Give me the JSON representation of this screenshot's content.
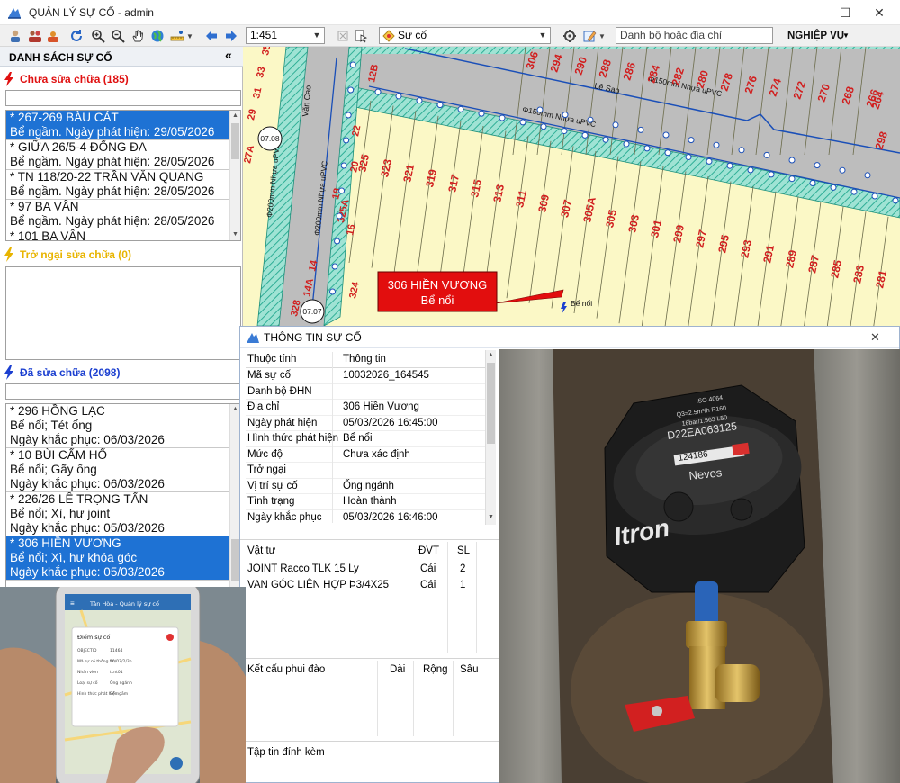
{
  "window": {
    "title": "QUẢN LÝ SỰ CỐ - admin",
    "minimize": "—",
    "maximize": "☐",
    "close": "✕"
  },
  "toolbar": {
    "scale_value": "1:451",
    "layer_value": "Sự cố",
    "search_placeholder": "Danh bộ hoặc địa chỉ",
    "menu_label": "NGHIỆP VỤ"
  },
  "left_panel": {
    "title": "DANH SÁCH SỰ CỐ",
    "collapse_icon": "«",
    "sections": {
      "pending": {
        "label": "Chưa sửa chữa (185)",
        "color": "#e01010",
        "items": [
          {
            "line1": "* 267-269 BÀU CÁT",
            "line2": "Bể ngầm. Ngày phát hiện: 29/05/2026",
            "selected": true
          },
          {
            "line1": "* GIỮA 26/5-4 ĐỐNG ĐA",
            "line2": "Bể ngầm. Ngày phát hiện: 28/05/2026"
          },
          {
            "line1": "* TN 118/20-22 TRẦN VĂN QUANG",
            "line2": "Bể ngầm. Ngày phát hiện: 28/05/2026"
          },
          {
            "line1": "* 97 BA VÂN",
            "line2": "Bể ngầm. Ngày phát hiện: 28/05/2026"
          },
          {
            "line1": "* 101 BA VÂN",
            "line2": ""
          }
        ]
      },
      "blocked": {
        "label": "Trở ngại sửa chữa (0)",
        "color": "#e8b400"
      },
      "fixed": {
        "label": "Đã sửa chữa (2098)",
        "color": "#1b3fd0",
        "items": [
          {
            "line1": "* 296 HỒNG LẠC",
            "line2": "Bể nổi; Tét ống",
            "line3": "Ngày khắc phục: 06/03/2026"
          },
          {
            "line1": "* 10 BÙI CẨM HỔ",
            "line2": "Bể nổi; Gãy ống",
            "line3": "Ngày khắc phục: 06/03/2026"
          },
          {
            "line1": "* 226/26 LÊ TRỌNG TẤN",
            "line2": "Bể nổi; Xì, hư joint",
            "line3": "Ngày khắc phục: 05/03/2026"
          },
          {
            "line1": "* 306 HIỀN VƯƠNG",
            "line2": "Bể nổi; Xì, hư khóa góc",
            "line3": "Ngày khắc phục: 05/03/2026",
            "selected": true
          }
        ]
      }
    }
  },
  "map": {
    "callout_title": "306 HIỀN VƯƠNG",
    "callout_sub": "Bể nổi",
    "marker_label": "Bể nổi",
    "street_van_cao": "Văn Cao",
    "street_le_sao": "Lê Sao",
    "pipe_le_sao": "Φ150mm Nhựa uPVC",
    "pipe_le_sao_2": "Φ150mm Nhựa uPVC",
    "pipe_van_cao": "Φ200mm Nhựa uPVC",
    "pipe_van_cao_2": "Φ200mm Nhựa uPVC",
    "zone_1": "07.08",
    "zone_2": "07.07",
    "parcels_top": [
      "306",
      "294",
      "290",
      "288",
      "286",
      "284",
      "282",
      "280",
      "278",
      "276",
      "274",
      "272",
      "270",
      "268",
      "266"
    ],
    "parcels_top2": [
      "298",
      "264"
    ],
    "parcels_mid": [
      "325",
      "323",
      "321",
      "319",
      "317",
      "315",
      "313",
      "311",
      "309",
      "307",
      "305A",
      "305",
      "303",
      "301",
      "299",
      "297",
      "295",
      "293",
      "291",
      "289",
      "287",
      "285",
      "283",
      "281"
    ],
    "parcels_left": [
      "35",
      "33",
      "31",
      "29",
      "27A",
      "22",
      "20",
      "16",
      "14",
      "14A",
      "12B",
      "325A",
      "324",
      "328",
      "18"
    ]
  },
  "info_window": {
    "title": "THÔNG TIN SỰ CỐ",
    "close": "✕",
    "header_attr": "Thuộc tính",
    "header_val": "Thông tin",
    "rows": [
      {
        "k": "Mã sự cố",
        "v": "10032026_164545"
      },
      {
        "k": "Danh bộ ĐHN",
        "v": ""
      },
      {
        "k": "Địa chỉ",
        "v": "306 Hiền Vương"
      },
      {
        "k": "Ngày phát hiện",
        "v": "05/03/2026 16:45:00"
      },
      {
        "k": "Hình thức phát hiện",
        "v": "Bể nổi"
      },
      {
        "k": "Mức độ",
        "v": "Chưa xác định"
      },
      {
        "k": "Trở ngại",
        "v": ""
      },
      {
        "k": "Vị trí sự cố",
        "v": "Ống ngánh"
      },
      {
        "k": "Tình trạng",
        "v": "Hoàn thành"
      },
      {
        "k": "Ngày khắc phục",
        "v": "05/03/2026 16:46:00"
      }
    ],
    "materials_headers": [
      "Vật tư",
      "ĐVT",
      "SL"
    ],
    "materials": [
      {
        "name": "JOINT Racco TLK 15 Ly",
        "unit": "Cái",
        "qty": "2"
      },
      {
        "name": "VAN GÓC LIÊN HỢP Þ3/4X25",
        "unit": "Cái",
        "qty": "1"
      }
    ],
    "excavation_headers": [
      "Kết cấu phui đào",
      "Dài",
      "Rộng",
      "Sâu"
    ],
    "attachments_label": "Tập tin đính kèm"
  },
  "photo": {
    "meter_brand": "Itron",
    "meter_model": "Nevos",
    "meter_serial": "D22EA063125",
    "meter_reading": "124186",
    "meter_spec": "ISO 4064",
    "meter_spec2": "Q3=2.5m³/h R160",
    "meter_spec3": "16bar/1.563 L50"
  },
  "phone": {
    "app_title": "Tân Hòa - Quản lý sự cố",
    "card_title": "Điểm sự cố",
    "field_1": "OBJECTID",
    "value_1": "11464",
    "field_2": "Mã sự cố thông tin",
    "value_2": "10/07/2/3h",
    "field_3": "Nhân viên",
    "value_3": "tcnt01",
    "field_4": "Loại sự cố",
    "value_4": "Ống ngánh",
    "field_5": "Hình thức phát hiện",
    "value_5": "Bể ngầm"
  },
  "colors": {
    "selection": "#1e72d4",
    "parcel_fill": "#fbf8c6",
    "road_fill": "#bdbdbd",
    "sidewalk_hatch": "#3fc1a8",
    "parcel_label": "#d11e1e",
    "pipe_blue": "#1a4fb8",
    "callout_red": "#e20e0e"
  }
}
